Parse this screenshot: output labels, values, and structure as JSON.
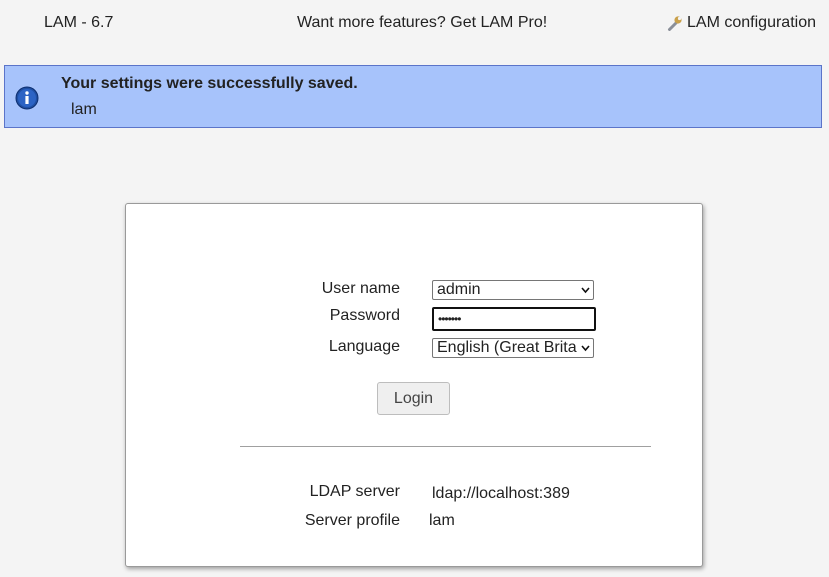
{
  "header": {
    "version": "LAM - 6.7",
    "promo": "Want more features? Get LAM Pro!",
    "config_link": "LAM configuration"
  },
  "alert": {
    "title": "Your settings were successfully saved.",
    "detail": "lam"
  },
  "login": {
    "user_label": "User name",
    "user_value": "admin",
    "password_label": "Password",
    "password_mask": "•••••••",
    "language_label": "Language",
    "language_value": "English (Great Brita",
    "button": "Login"
  },
  "server": {
    "ldap_label": "LDAP server",
    "ldap_value": "ldap://localhost:389",
    "profile_label": "Server profile",
    "profile_value": "lam"
  }
}
